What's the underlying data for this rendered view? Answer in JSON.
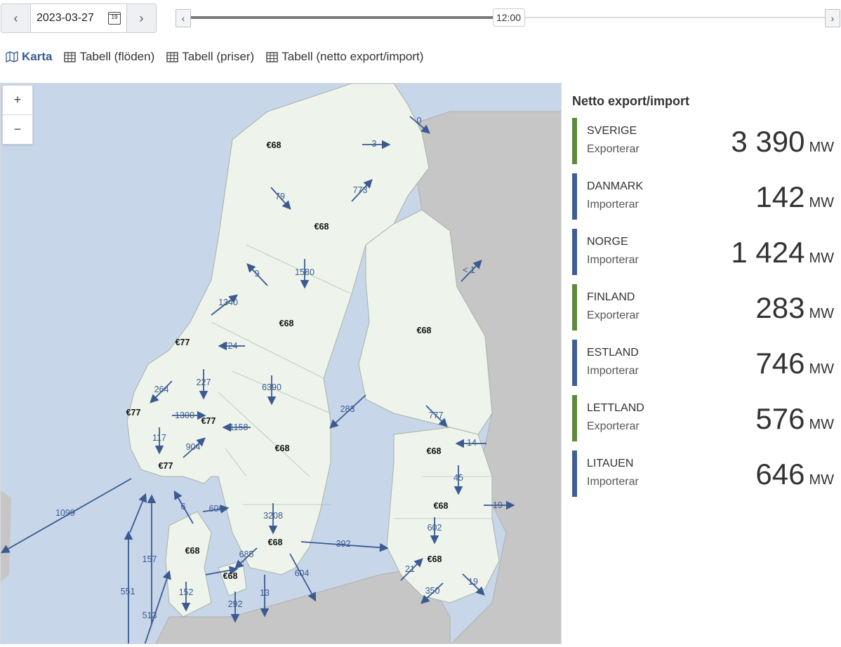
{
  "date": {
    "prev_icon": "chevron-left-icon",
    "value": "2023-03-27",
    "calendar_icon": "calendar-icon",
    "calendar_day": "19",
    "next_icon": "chevron-right-icon"
  },
  "time_slider": {
    "label": "12:00",
    "progress": 0.5
  },
  "tabs": [
    {
      "label": "Karta",
      "icon": "map-icon",
      "active": true
    },
    {
      "label": "Tabell (flöden)",
      "icon": "table-icon",
      "active": false
    },
    {
      "label": "Tabell (priser)",
      "icon": "table-icon",
      "active": false
    },
    {
      "label": "Tabell (netto export/import)",
      "icon": "table-icon",
      "active": false
    }
  ],
  "zoom": {
    "in": "+",
    "out": "−"
  },
  "prices": {
    "se1": "€68",
    "se2": "€68",
    "se3": "€68",
    "se4": "€68",
    "no4": "€68",
    "no3": "€77",
    "no5": "€77",
    "no1": "€77",
    "no2": "€77",
    "fi": "€68",
    "ee": "€68",
    "lv": "€68",
    "lt": "€68",
    "dk1": "€68",
    "dk2": "€68"
  },
  "flows": {
    "f0": "0",
    "f3": "3",
    "f79": "79",
    "f773": "773",
    "f1580": "1580",
    "f9": "9",
    "f1340": "1340",
    "f1": "< 1",
    "f724": "724",
    "f227": "227",
    "f264": "264",
    "f6390": "6390",
    "f1300": "1300",
    "f1158": "1158",
    "f117": "117",
    "f904": "904",
    "f283": "283",
    "f777": "777",
    "f14": "14",
    "f45": "45",
    "f19a": "19",
    "f1099": "1099",
    "f6": "6",
    "f606": "606",
    "f3208": "3208",
    "f602": "602",
    "f392": "392",
    "f685": "685",
    "f157": "157",
    "f21": "21",
    "f604": "604",
    "f19b": "19",
    "f551": "551",
    "f152": "152",
    "f13": "13",
    "f350": "350",
    "f292": "292",
    "f513": "513"
  },
  "panel": {
    "title": "Netto export/import",
    "unit": "MW",
    "cards": [
      {
        "name": "SVERIGE",
        "status": "Exporterar",
        "value": "3 390",
        "color": "#5b8a3a"
      },
      {
        "name": "DANMARK",
        "status": "Importerar",
        "value": "142",
        "color": "#3f5e93"
      },
      {
        "name": "NORGE",
        "status": "Importerar",
        "value": "1 424",
        "color": "#3f5e93"
      },
      {
        "name": "FINLAND",
        "status": "Exporterar",
        "value": "283",
        "color": "#5b8a3a"
      },
      {
        "name": "ESTLAND",
        "status": "Importerar",
        "value": "746",
        "color": "#3f5e93"
      },
      {
        "name": "LETTLAND",
        "status": "Exporterar",
        "value": "576",
        "color": "#5b8a3a"
      },
      {
        "name": "LITAUEN",
        "status": "Importerar",
        "value": "646",
        "color": "#3f5e93"
      }
    ]
  },
  "colors": {
    "sea": "#c8d6e9",
    "land_nordic": "#eef4ec",
    "land_other": "#c6c6c6",
    "arrow": "#3a5a91",
    "accent": "#3a5a91",
    "export_bar": "#5b8a3a",
    "import_bar": "#3f5e93"
  }
}
